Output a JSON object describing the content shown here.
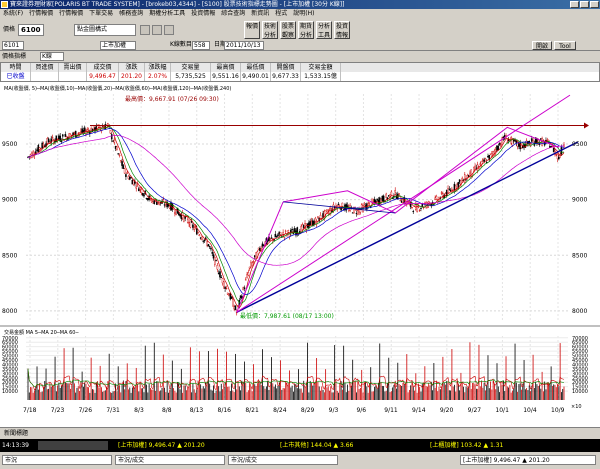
{
  "window": {
    "title": "寶來證券理財家[POLARIS BT TRADE SYSTEM] - [brokeb03,4344] - [S100] 股票技術指標走勢圖 - [上市加權 [30分 K線]]"
  },
  "menu": [
    "系統(F)",
    "行情報價",
    "行情報價",
    "下單交易",
    "帳務查詢",
    "期權分析工具",
    "投資情報",
    "綜合查詢",
    "新資訊",
    "程式",
    "說明(H)"
  ],
  "toolbar": {
    "symbol_label": "價格",
    "symbol_value": "6100",
    "style_value": "點金圖構式",
    "buttons": [
      "報價",
      "技術分析",
      "股票觀察",
      "期貨分析",
      "分析工具",
      "投資情報"
    ],
    "right_buttons": [
      "開啟",
      "Tool"
    ]
  },
  "subbar": {
    "code": "6101",
    "name": "上市加權",
    "period_label": "K線數目",
    "period_value": "558",
    "date_label": "日期",
    "date_value": "2011/10/13"
  },
  "tabstrip": {
    "tabs": [
      "價格指標",
      "K線"
    ]
  },
  "quote": {
    "headers": [
      "時間",
      "買進價",
      "賣出價",
      "成交價",
      "漲跌",
      "漲跌幅",
      "交易量",
      "最高價",
      "最低價",
      "開盤價",
      "交易金額"
    ],
    "values": [
      "已收盤",
      "",
      "",
      "9,496.47",
      "201.20",
      "2.07%",
      "5,735,525",
      "9,551.16",
      "9,490.01",
      "9,677.33",
      "1,533.15億"
    ]
  },
  "chart_data": {
    "type": "line",
    "legend_text": "MA(收盤價, 5)─MA(收盤價,10)─MA(收盤價,20)─MA(收盤價,60)─MA(收盤價,120)─MA(收盤價,240)",
    "x_ticks": [
      "7/18",
      "7/23",
      "7/26",
      "7/31",
      "8/3",
      "8/8",
      "8/13",
      "8/16",
      "8/21",
      "8/24",
      "8/29",
      "9/3",
      "9/6",
      "9/11",
      "9/14",
      "9/20",
      "9/27",
      "10/1",
      "10/4",
      "10/9"
    ],
    "y_ticks": [
      8000,
      8500,
      9000,
      9500
    ],
    "ylim": [
      7900,
      9950
    ],
    "high_annotation": "最高價：9,667.91 (07/26 09:30)",
    "low_annotation": "最低價：7,987.61 (08/17 13:00)",
    "volume": {
      "title": "交易金額 MA  5─MA 20─MA 60─",
      "y_ticks": [
        10000,
        15000,
        20000,
        25000,
        30000,
        35000,
        40000,
        45000,
        50000,
        55000,
        60000,
        65000,
        70000
      ],
      "ylim": [
        0,
        72000
      ],
      "unit_label": "×10"
    },
    "colors": {
      "candle_up": "#cc0000",
      "candle_down": "#000000",
      "ma5": "#cc0000",
      "ma10": "#008800",
      "ma20": "#0000cc",
      "ma60": "#cc00cc",
      "channel": "#cc00cc",
      "trendline": "#000099",
      "highline": "#990000",
      "low_text": "#009900"
    }
  },
  "bottom": {
    "panel_label": "新聞標題",
    "time": "14:13:39",
    "tickers": [
      "[上市加權] 9,496.47 ▲ 201.20",
      "[上市其他] 144.04 ▲ 3.66",
      "[上櫃加權] 103.42 ▲ 1.31"
    ],
    "status": [
      "市況",
      "市況/成交",
      "市況/成交",
      "[上市加權] 9,496.47 ▲ 201.20"
    ]
  }
}
